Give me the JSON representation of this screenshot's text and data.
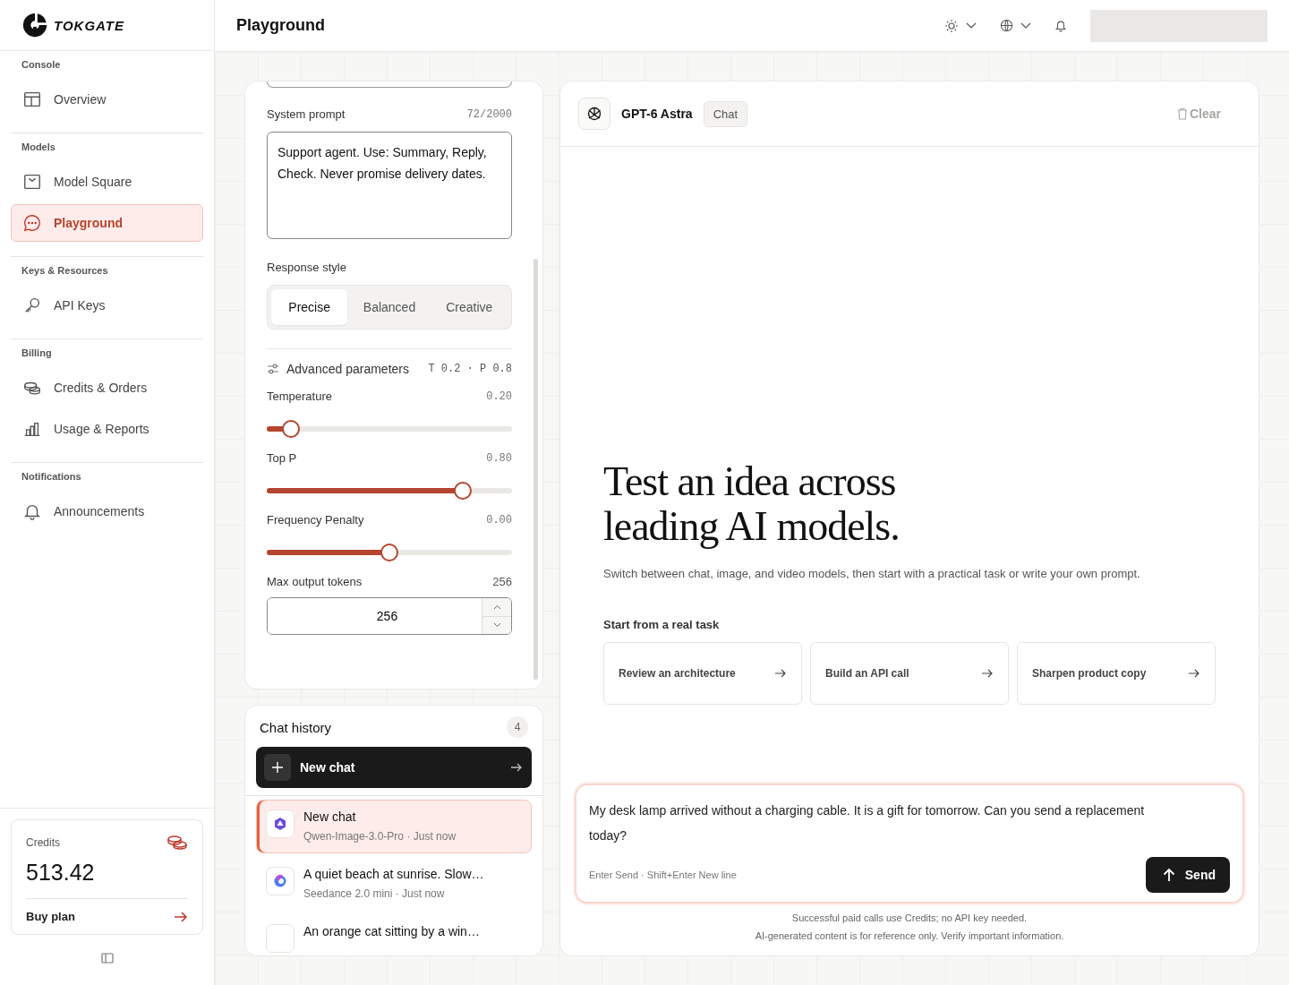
{
  "sidebar": {
    "logo": "TOKGATE",
    "sections": [
      {
        "title": "Console",
        "items": [
          {
            "label": "Overview",
            "selected": false
          }
        ]
      },
      {
        "title": "Models",
        "items": [
          {
            "label": "Model Square",
            "selected": false
          },
          {
            "label": "Playground",
            "selected": true
          }
        ]
      },
      {
        "title": "Keys & Resources",
        "items": [
          {
            "label": "API Keys",
            "selected": false
          }
        ]
      },
      {
        "title": "Billing",
        "items": [
          {
            "label": "Credits & Orders",
            "selected": false
          },
          {
            "label": "Usage & Reports",
            "selected": false
          }
        ]
      },
      {
        "title": "Notifications",
        "items": [
          {
            "label": "Announcements",
            "selected": false
          }
        ]
      }
    ],
    "credits": {
      "label": "Credits",
      "amount": "513.42",
      "action": "Buy plan"
    }
  },
  "header": {
    "title": "Playground"
  },
  "settings": {
    "system_prompt": {
      "label": "System prompt",
      "count": "72/2000",
      "value": "Support agent. Use: Summary, Reply, Check. Never promise delivery dates."
    },
    "response_style": {
      "label": "Response style",
      "options": [
        {
          "label": "Precise",
          "selected": true
        },
        {
          "label": "Balanced",
          "selected": false
        },
        {
          "label": "Creative",
          "selected": false
        }
      ]
    },
    "advanced": {
      "label": "Advanced parameters",
      "summary": "T 0.2 · P 0.8"
    },
    "sliders": [
      {
        "label": "Temperature",
        "reading": "0.20",
        "level": 0.1
      },
      {
        "label": "Top P",
        "reading": "0.80",
        "level": 0.8
      },
      {
        "label": "Frequency Penalty",
        "reading": "0.00",
        "level": 0.5
      }
    ],
    "max_tokens": {
      "label": "Max output tokens",
      "reading": "256",
      "value": "256"
    }
  },
  "history": {
    "title": "Chat history",
    "count": "4",
    "new_chat": "New chat",
    "items": [
      {
        "title": "New chat",
        "meta": "Qwen-Image-3.0-Pro · Just now",
        "selected": true
      },
      {
        "title": "A quiet beach at sunrise. Slow…",
        "meta": "Seedance 2.0 mini · Just now",
        "selected": false
      },
      {
        "title": "An orange cat sitting by a win…",
        "selected": false
      }
    ]
  },
  "chat": {
    "model": "GPT-6 Astra",
    "mode": "Chat",
    "clear": {
      "label": "Clear",
      "disabled": true
    },
    "headline": "Test an idea across leading AI models.",
    "subtitle": "Switch between chat, image, and video models, then start with a practical task or write your own prompt.",
    "tasks_title": "Start from a real task",
    "tasks": [
      "Review an architecture",
      "Build an API call",
      "Sharpen product copy"
    ],
    "composer": {
      "value": "My desk lamp arrived without a charging cable. It is a gift for tomorrow. Can you send a replacement today?",
      "hint": "Enter Send · Shift+Enter New line",
      "send": "Send"
    },
    "notes": [
      "Successful paid calls use Credits; no API key needed.",
      "AI-generated content is for reference only. Verify important information."
    ]
  }
}
